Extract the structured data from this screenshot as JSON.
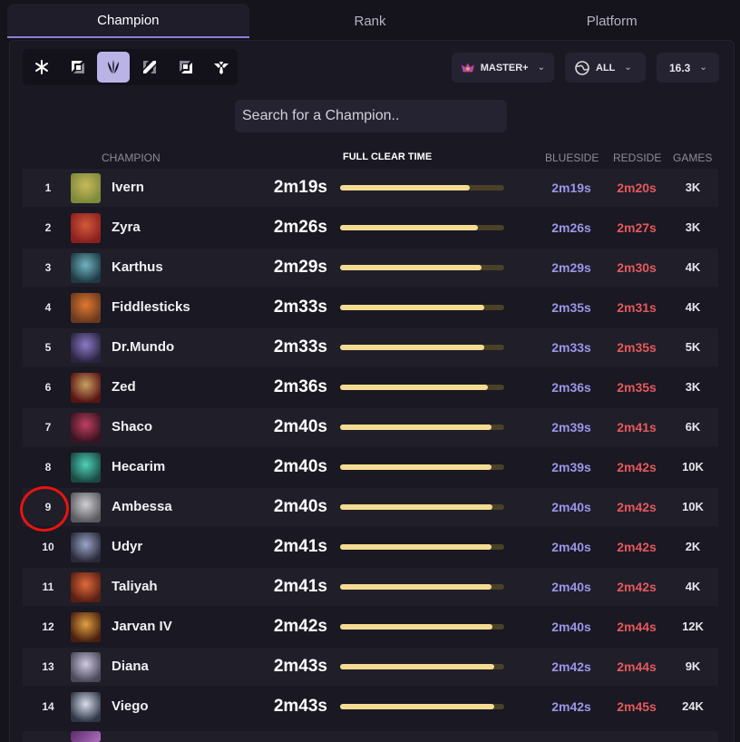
{
  "tabs": [
    "Champion",
    "Rank",
    "Platform"
  ],
  "filters": {
    "rank": "MASTER+",
    "platform": "ALL",
    "patch": "16.3",
    "search_placeholder": "Search for a Champion.."
  },
  "roles": [
    "all-roles-icon",
    "top-icon",
    "jungle-icon",
    "mid-icon",
    "bot-icon",
    "support-icon"
  ],
  "headers": {
    "champion": "CHAMPION",
    "clear_time": "FULL CLEAR TIME",
    "blueside": "BLUESIDE",
    "redside": "REDSIDE",
    "games": "GAMES"
  },
  "colors": {
    "accent": "#8b7fd6",
    "blue_side": "#9d95ea",
    "red_side": "#e4595c",
    "bar_fill": "#f3dc92"
  },
  "rows": [
    {
      "rank": "1",
      "name": "Ivern",
      "time": "2m19s",
      "fill": 0.79,
      "blue": "2m19s",
      "red": "2m20s",
      "games": "3K",
      "c1": "#7d8a3a",
      "c2": "#c8b95a"
    },
    {
      "rank": "2",
      "name": "Zyra",
      "time": "2m26s",
      "fill": 0.84,
      "blue": "2m26s",
      "red": "2m27s",
      "games": "3K",
      "c1": "#8c1f1f",
      "c2": "#d25a3a"
    },
    {
      "rank": "3",
      "name": "Karthus",
      "time": "2m29s",
      "fill": 0.86,
      "blue": "2m29s",
      "red": "2m30s",
      "games": "4K",
      "c1": "#1f3a44",
      "c2": "#6fb4bf"
    },
    {
      "rank": "4",
      "name": "Fiddlesticks",
      "time": "2m33s",
      "fill": 0.88,
      "blue": "2m35s",
      "red": "2m31s",
      "games": "4K",
      "c1": "#6a3a1f",
      "c2": "#e0782f"
    },
    {
      "rank": "5",
      "name": "Dr.Mundo",
      "time": "2m33s",
      "fill": 0.88,
      "blue": "2m33s",
      "red": "2m35s",
      "games": "5K",
      "c1": "#2a2440",
      "c2": "#8c7ac8"
    },
    {
      "rank": "6",
      "name": "Zed",
      "time": "2m36s",
      "fill": 0.9,
      "blue": "2m36s",
      "red": "2m35s",
      "games": "3K",
      "c1": "#5a1414",
      "c2": "#c8a060"
    },
    {
      "rank": "7",
      "name": "Shaco",
      "time": "2m40s",
      "fill": 0.92,
      "blue": "2m39s",
      "red": "2m41s",
      "games": "6K",
      "c1": "#3a1420",
      "c2": "#c04060"
    },
    {
      "rank": "8",
      "name": "Hecarim",
      "time": "2m40s",
      "fill": 0.92,
      "blue": "2m39s",
      "red": "2m42s",
      "games": "10K",
      "c1": "#1a4a44",
      "c2": "#4fd0b8"
    },
    {
      "rank": "9",
      "name": "Ambessa",
      "time": "2m40s",
      "fill": 0.93,
      "blue": "2m40s",
      "red": "2m42s",
      "games": "10K",
      "c1": "#5a5a60",
      "c2": "#cfcfd4"
    },
    {
      "rank": "10",
      "name": "Udyr",
      "time": "2m41s",
      "fill": 0.92,
      "blue": "2m40s",
      "red": "2m42s",
      "games": "2K",
      "c1": "#2a2a3a",
      "c2": "#9aa4c8"
    },
    {
      "rank": "11",
      "name": "Taliyah",
      "time": "2m41s",
      "fill": 0.92,
      "blue": "2m40s",
      "red": "2m42s",
      "games": "4K",
      "c1": "#5a1f14",
      "c2": "#e06a3a"
    },
    {
      "rank": "12",
      "name": "Jarvan IV",
      "time": "2m42s",
      "fill": 0.93,
      "blue": "2m40s",
      "red": "2m44s",
      "games": "12K",
      "c1": "#4a2010",
      "c2": "#e0a040"
    },
    {
      "rank": "13",
      "name": "Diana",
      "time": "2m43s",
      "fill": 0.94,
      "blue": "2m42s",
      "red": "2m44s",
      "games": "9K",
      "c1": "#4a4a5a",
      "c2": "#d0c8e0"
    },
    {
      "rank": "14",
      "name": "Viego",
      "time": "2m43s",
      "fill": 0.94,
      "blue": "2m42s",
      "red": "2m45s",
      "games": "24K",
      "c1": "#303848",
      "c2": "#d8dcea"
    }
  ]
}
